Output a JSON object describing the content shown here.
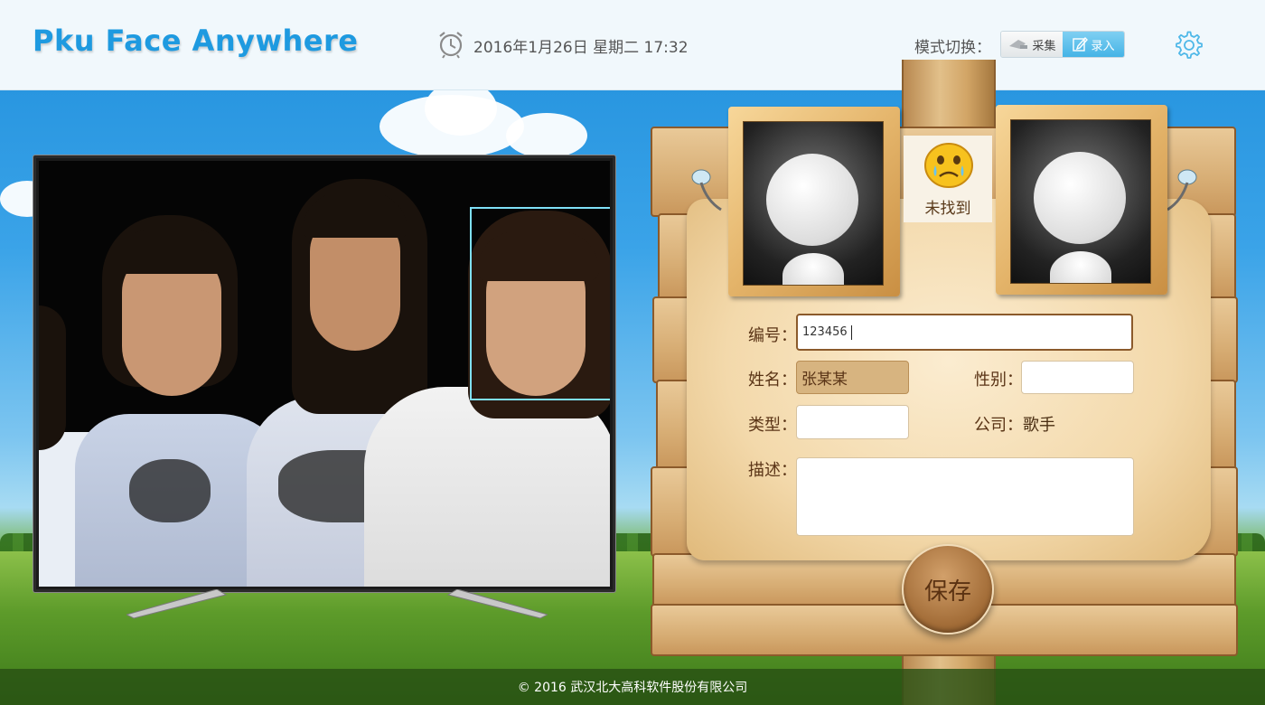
{
  "header": {
    "title": "Pku Face Anywhere",
    "datetime": "2016年1月26日  星期二  17:32",
    "mode_label": "模式切换：",
    "mode_collect": "采集",
    "mode_entry": "录入"
  },
  "status": {
    "text": "未找到"
  },
  "form": {
    "id_label": "编号：",
    "id_value": "123456",
    "name_label": "姓名：",
    "name_value": "张某某",
    "gender_label": "性别：",
    "gender_value": "",
    "type_label": "类型：",
    "type_value": "",
    "company_label": "公司：",
    "company_value": "歌手",
    "desc_label": "描述：",
    "desc_value": "",
    "save_label": "保存"
  },
  "footer": {
    "copyright": "© 2016 武汉北大高科软件股份有限公司"
  },
  "colors": {
    "title": "#1e9ae0",
    "mode_active": "#45b4e6",
    "face_box": "#7fe0f7",
    "wood": "#d7ad74"
  },
  "icons": {
    "clock": "alarm-clock-icon",
    "gear": "gear-icon",
    "collect": "camera-icon",
    "entry": "edit-icon",
    "status": "crying-emoji-icon"
  }
}
